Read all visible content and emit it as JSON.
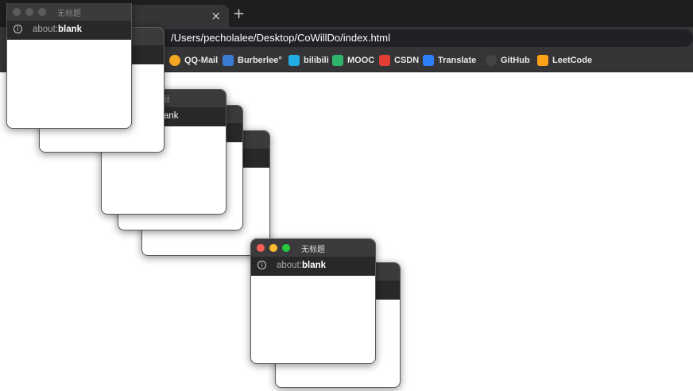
{
  "browser": {
    "tab_close": "×",
    "new_tab": "+",
    "url": "/Users/pecholalee/Desktop/CoWillDo/index.html"
  },
  "bookmarks": [
    {
      "label": "QQ-Mail",
      "icon": "qq-mail-icon",
      "color": "#f5a623"
    },
    {
      "label": "Burberlee°",
      "icon": "burberlee-icon",
      "color": "#3a7bd5"
    },
    {
      "label": "bilibili",
      "icon": "bilibili-icon",
      "color": "#23ade5"
    },
    {
      "label": "MOOC",
      "icon": "mooc-icon",
      "color": "#2fb56a"
    },
    {
      "label": "CSDN",
      "icon": "csdn-icon",
      "color": "#e33e33"
    },
    {
      "label": "Translate",
      "icon": "translate-icon",
      "color": "#2d7ff9"
    },
    {
      "label": "GitHub",
      "icon": "github-icon",
      "color": "#444444"
    },
    {
      "label": "LeetCode",
      "icon": "leetcode-icon",
      "color": "#ffa116"
    }
  ],
  "popup": {
    "title": "无标题",
    "info_glyph": "i",
    "addr_prefix": "about:",
    "addr_bold": "blank",
    "fragment_title": "标题",
    "fragment_addr": "ank"
  },
  "colors": {
    "close": "#ff5f57",
    "minimize": "#febc2e",
    "zoom": "#28c840"
  }
}
